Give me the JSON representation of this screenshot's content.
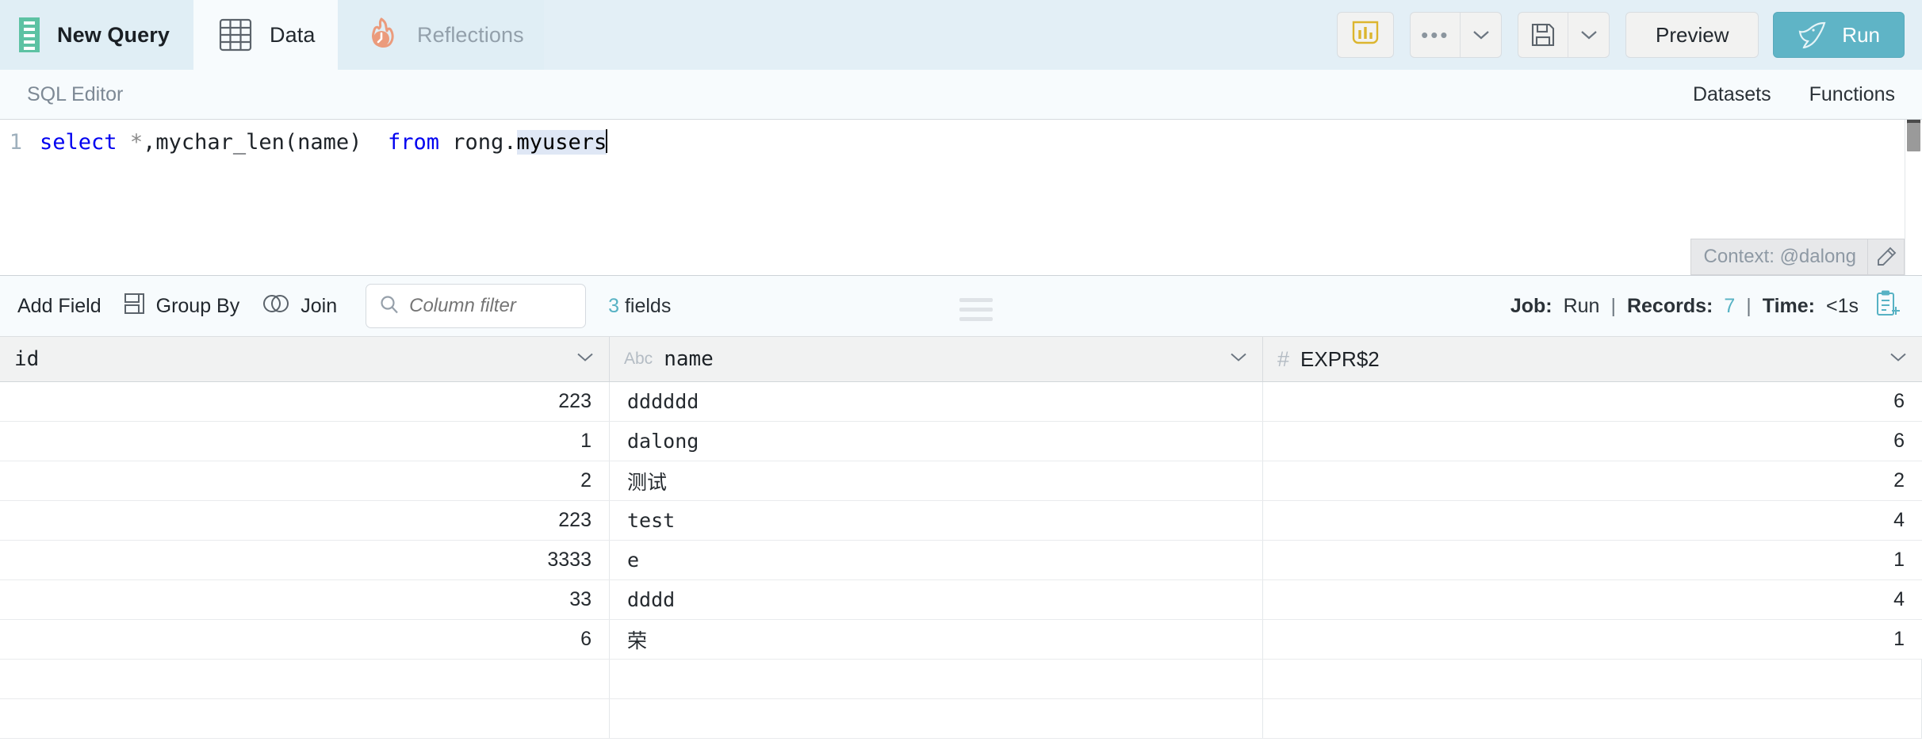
{
  "tabs": [
    {
      "id": "new-query",
      "label": "New Query",
      "icon": "query-icon"
    },
    {
      "id": "data",
      "label": "Data",
      "icon": "table-grid-icon"
    },
    {
      "id": "reflections",
      "label": "Reflections",
      "icon": "flame-clock-icon"
    }
  ],
  "toolbar": {
    "chart_icon": "bar-chart-icon",
    "more_icon": "ellipsis-icon",
    "more_caret": "chevron-down-icon",
    "save_icon": "floppy-disk-icon",
    "save_caret": "chevron-down-icon",
    "preview_label": "Preview",
    "run_label": "Run",
    "run_icon": "dolphin-icon",
    "run_bg": "#5fb4c6"
  },
  "editor": {
    "title": "SQL Editor",
    "links": [
      "Datasets",
      "Functions"
    ],
    "line_number": "1",
    "sql_tokens": [
      {
        "t": "select",
        "k": "kw"
      },
      {
        "t": " ",
        "k": "plain"
      },
      {
        "t": "*",
        "k": "op"
      },
      {
        "t": ",mychar_len(name)  ",
        "k": "plain"
      },
      {
        "t": "from",
        "k": "kw"
      },
      {
        "t": " rong.",
        "k": "plain"
      },
      {
        "t": "myusers",
        "k": "sel"
      }
    ],
    "sql_text": "select *,mychar_len(name)  from rong.myusers",
    "context_label": "Context: @dalong",
    "context_edit_icon": "pencil-icon"
  },
  "results_toolbar": {
    "add_field": "Add Field",
    "group_by": "Group By",
    "group_by_icon": "group-by-icon",
    "join": "Join",
    "join_icon": "venn-join-icon",
    "filter_placeholder": "Column filter",
    "filter_value": "",
    "filter_icon": "search-icon",
    "fields_count": "3",
    "fields_label": "fields",
    "drag_handle": "resize-grip-icon"
  },
  "status": {
    "job_label": "Job:",
    "job_value": "Run",
    "records_label": "Records:",
    "records_value": "7",
    "time_label": "Time:",
    "time_value": "<1s",
    "copy_icon": "clipboard-plus-icon",
    "accent": "#57b2c4"
  },
  "grid": {
    "columns": [
      {
        "name": "id",
        "type_icon": "",
        "align": "num",
        "font": "mono"
      },
      {
        "name": "name",
        "type_icon": "Abc",
        "align": "txt",
        "font": "mono"
      },
      {
        "name": "EXPR$2",
        "type_icon": "#",
        "align": "num",
        "font": "sans"
      }
    ],
    "rows": [
      {
        "id": "223",
        "name": "dddddd",
        "expr": "6"
      },
      {
        "id": "1",
        "name": "dalong",
        "expr": "6"
      },
      {
        "id": "2",
        "name": "测试",
        "expr": "2"
      },
      {
        "id": "223",
        "name": "test",
        "expr": "4"
      },
      {
        "id": "3333",
        "name": "e",
        "expr": "1"
      },
      {
        "id": "33",
        "name": "dddd",
        "expr": "4"
      },
      {
        "id": "6",
        "name": "荣",
        "expr": "1"
      }
    ]
  }
}
